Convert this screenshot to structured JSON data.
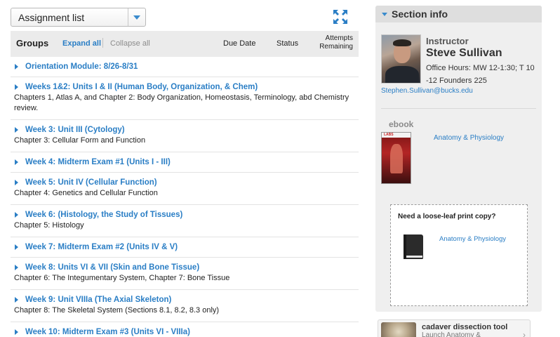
{
  "view_select": {
    "value": "Assignment list"
  },
  "groups_header": {
    "title": "Groups",
    "expand_all": "Expand all",
    "collapse_all": "Collapse all",
    "col_due": "Due Date",
    "col_status": "Status",
    "col_attempts_line1": "Attempts",
    "col_attempts_line2": "Remaining"
  },
  "groups": [
    {
      "title": "Orientation Module: 8/26-8/31",
      "desc": ""
    },
    {
      "title": "Weeks 1&2: Units I & II (Human Body, Organization, & Chem)",
      "desc": "Chapters 1, Atlas A, and Chapter 2: Body Organization, Homeostasis, Terminology, abd Chemistry review."
    },
    {
      "title": "Week 3: Unit III (Cytology)",
      "desc": "Chapter 3: Cellular Form and Function"
    },
    {
      "title": "Week 4: Midterm Exam #1 (Units I - III)",
      "desc": ""
    },
    {
      "title": "Week 5: Unit IV (Cellular Function)",
      "desc": "Chapter 4: Genetics and Cellular Function"
    },
    {
      "title": "Week 6: (Histology, the Study of Tissues)",
      "desc": "Chapter 5: Histology"
    },
    {
      "title": "Week 7: Midterm Exam #2 (Units IV & V)",
      "desc": ""
    },
    {
      "title": "Week 8: Units VI & VII (Skin and Bone Tissue)",
      "desc": "Chapter 6: The Integumentary System, Chapter 7: Bone Tissue"
    },
    {
      "title": "Week 9: Unit VIIIa (The Axial Skeleton)",
      "desc": "Chapter 8: The Skeletal System (Sections 8.1, 8.2, 8.3 only)"
    },
    {
      "title": "Week 10: Midterm Exam #3 (Units VI - VIIIa)",
      "desc": ""
    }
  ],
  "section_info": {
    "title": "Section info",
    "instructor_label": "Instructor",
    "instructor_name": "Steve Sullivan",
    "office_hours": "Office Hours: MW 12-1:30; T 10 -12 Founders 225",
    "email": "Stephen.Sullivan@bucks.edu",
    "ebook_label": "ebook",
    "ebook_link": "Anatomy & Physiology",
    "ebook_cover_brand": "LABS",
    "print_question": "Need a loose-leaf print copy?",
    "print_link": "Anatomy & Physiology"
  },
  "cadaver_tile": {
    "title": "cadaver dissection tool",
    "subtitle": "Launch Anatomy &"
  },
  "colors": {
    "link": "#2a7ec5",
    "header_bg": "#ebebeb",
    "panel_bg": "#efefef"
  },
  "icons": {
    "dropdown": "chevron-down-icon",
    "fullscreen": "expand-arrows-icon",
    "group_caret": "caret-right-icon",
    "print_book": "book-icon"
  }
}
